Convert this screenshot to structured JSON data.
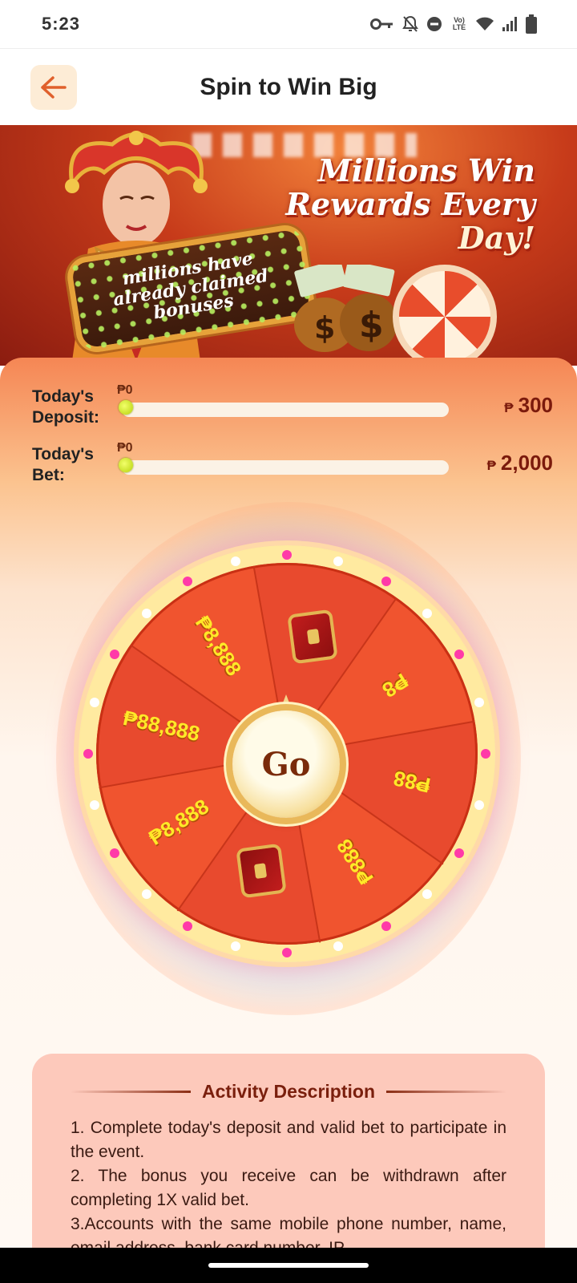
{
  "status_bar": {
    "time": "5:23",
    "icons": [
      "key-icon",
      "bell-off-icon",
      "do-not-disturb-icon",
      "volte-icon",
      "wifi-icon",
      "signal-icon",
      "battery-icon"
    ],
    "volte_label": "Vo) LTE"
  },
  "header": {
    "title": "Spin to Win Big",
    "back_icon": "arrow-left-icon"
  },
  "banner": {
    "headline_line1": "Millions Win",
    "headline_line2": "Rewards Every",
    "headline_line3": "Day!",
    "sign_line1": "millions have",
    "sign_line2": "already claimed",
    "sign_line3": "bonuses"
  },
  "progress": {
    "deposit": {
      "label_line1": "Today's",
      "label_line2": "Deposit:",
      "current": "₱0",
      "target": "300",
      "currency": "₱",
      "fraction": 0
    },
    "bet": {
      "label_line1": "Today's",
      "label_line2": "Bet:",
      "current": "₱0",
      "target": "2,000",
      "currency": "₱",
      "fraction": 0
    }
  },
  "wheel": {
    "go_label": "Go",
    "segments": [
      {
        "type": "text",
        "label": "₱8,888"
      },
      {
        "type": "icon",
        "icon": "treasure-chest-icon"
      },
      {
        "type": "text",
        "label": "₱8"
      },
      {
        "type": "text",
        "label": "₱88"
      },
      {
        "type": "text",
        "label": "₱888"
      },
      {
        "type": "icon",
        "icon": "treasure-chest-icon"
      },
      {
        "type": "text",
        "label": "₱8,888"
      },
      {
        "type": "text",
        "label": "₱88,888"
      }
    ]
  },
  "description": {
    "title": "Activity Description",
    "items": [
      "1. Complete today's deposit and valid bet to participate in the event.",
      "2. The bonus you receive can be withdrawn after completing 1X valid bet.",
      "3.Accounts with the same mobile phone number, name, email address, bank card number, IP"
    ]
  },
  "colors": {
    "accent": "#e84a2e",
    "title_dark": "#7a1f0d",
    "wheel_text": "#ffe928",
    "progress_knob": "#c8e020"
  }
}
